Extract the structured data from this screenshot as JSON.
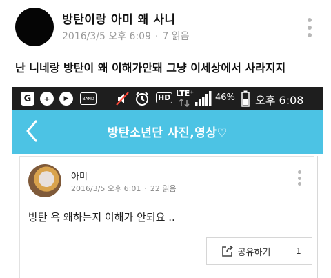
{
  "post": {
    "title": "방탄이랑 아미 왜 사니",
    "date": "2016/3/5 오후 6:09",
    "separator": "·",
    "reads": "7 읽음",
    "body": "난 니네랑 방탄이 왜 이해가안돼 그냥 이세상에서 사라지지"
  },
  "screenshot": {
    "status_bar": {
      "band_label": "BAND",
      "battery_percent": "46%",
      "time": "오후 6:08",
      "lte_label": "LTE⁺",
      "hd_label": "HD"
    },
    "board_title": "방탄소년단 사진,영상♡",
    "card": {
      "author": "아미",
      "date": "2016/3/5 오후 6:01",
      "separator": "·",
      "reads": "22 읽음",
      "body": "방탄 욕 왜하는지 이해가 안되요 ..",
      "share_label": "공유하기",
      "share_count": "1"
    }
  },
  "colors": {
    "board_accent": "#4cc3e4",
    "status_bar_bg": "#1e1e1e",
    "meta_text": "#9a9a9a"
  },
  "icons": [
    "more-vertical-icon",
    "back-chevron-icon",
    "share-icon",
    "mute-icon",
    "alarm-icon",
    "signal-icon",
    "battery-icon"
  ]
}
